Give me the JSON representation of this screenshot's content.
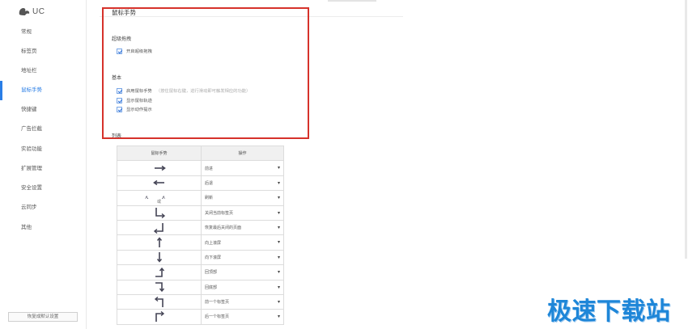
{
  "logo_text": "UC",
  "sidebar": {
    "items": [
      {
        "label": "常规",
        "active": false
      },
      {
        "label": "标签页",
        "active": false
      },
      {
        "label": "地址栏",
        "active": false
      },
      {
        "label": "鼠标手势",
        "active": true
      },
      {
        "label": "快捷键",
        "active": false
      },
      {
        "label": "广告拦截",
        "active": false
      },
      {
        "label": "实验功能",
        "active": false
      },
      {
        "label": "扩展管理",
        "active": false
      },
      {
        "label": "安全设置",
        "active": false
      },
      {
        "label": "云同步",
        "active": false
      },
      {
        "label": "其他",
        "active": false
      }
    ],
    "reset_label": "恢复成默认设置"
  },
  "main": {
    "section_title": "鼠标手势",
    "super_drag": {
      "heading": "超级拖拽",
      "option": "开启超级拖拽"
    },
    "basic": {
      "heading": "基本",
      "options": [
        {
          "label": "启用鼠标手势",
          "hint": "（按住鼠标右键，进行滑动即可触发相应的功能）"
        },
        {
          "label": "显示鼠标轨迹",
          "hint": ""
        },
        {
          "label": "显示动作提示",
          "hint": ""
        }
      ]
    },
    "list_heading": "列表",
    "table": {
      "headers": [
        "鼠标手势",
        "操作"
      ],
      "rows": [
        {
          "gesture": "right-arrow-icon",
          "action": "前进"
        },
        {
          "gesture": "left-arrow-icon",
          "action": "后退"
        },
        {
          "gesture": "up-down-icon",
          "or_text": "或",
          "action": "刷新"
        },
        {
          "gesture": "down-right-icon",
          "action": "关闭当前标签页"
        },
        {
          "gesture": "down-left-icon",
          "action": "恢复最后关闭的页面"
        },
        {
          "gesture": "up-arrow-icon",
          "action": "向上滚屏"
        },
        {
          "gesture": "down-arrow-icon",
          "action": "向下滚屏"
        },
        {
          "gesture": "right-up-icon",
          "action": "回顶部"
        },
        {
          "gesture": "right-down-icon",
          "action": "回底部"
        },
        {
          "gesture": "up-left-icon",
          "action": "前一个标签页"
        },
        {
          "gesture": "up-right-icon",
          "action": "后一个标签页"
        }
      ]
    }
  },
  "watermark": "极速下载站",
  "colors": {
    "accent": "#2a7ee6",
    "highlight": "#d6322b",
    "watermark": "#1e86d8"
  }
}
